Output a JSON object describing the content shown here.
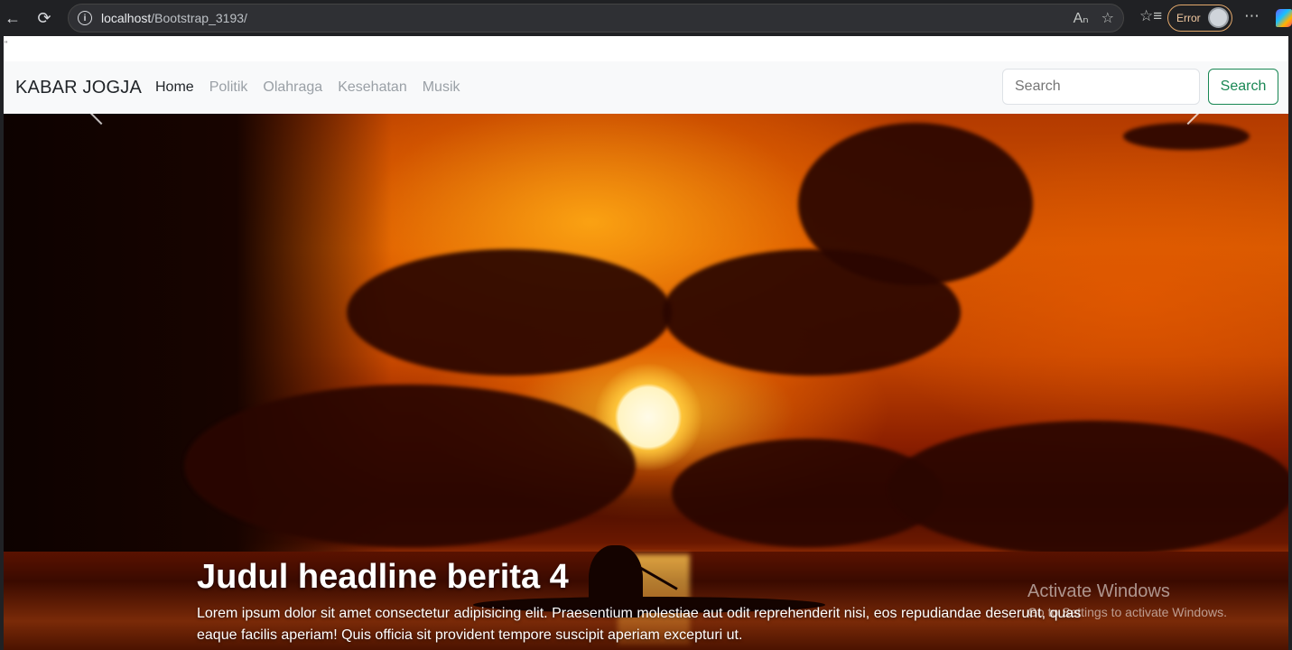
{
  "browser": {
    "url_host": "localhost",
    "url_path": "/Bootstrap_3193/",
    "profile_status": "Error"
  },
  "page": {
    "stray_text": "\""
  },
  "navbar": {
    "brand": "KABAR JOGJA",
    "links": [
      {
        "label": "Home",
        "active": true
      },
      {
        "label": "Politik",
        "active": false
      },
      {
        "label": "Olahraga",
        "active": false
      },
      {
        "label": "Kesehatan",
        "active": false
      },
      {
        "label": "Musik",
        "active": false
      }
    ],
    "search_placeholder": "Search",
    "search_button": "Search"
  },
  "carousel": {
    "caption_title": "Judul headline berita 4",
    "caption_text": "Lorem ipsum dolor sit amet consectetur adipisicing elit. Praesentium molestiae aut odit reprehenderit nisi, eos repudiandae deserunt, quas eaque facilis aperiam! Quis officia sit provident tempore suscipit aperiam excepturi ut."
  },
  "watermark": {
    "title": "Activate Windows",
    "subtitle": "Go to Settings to activate Windows."
  }
}
